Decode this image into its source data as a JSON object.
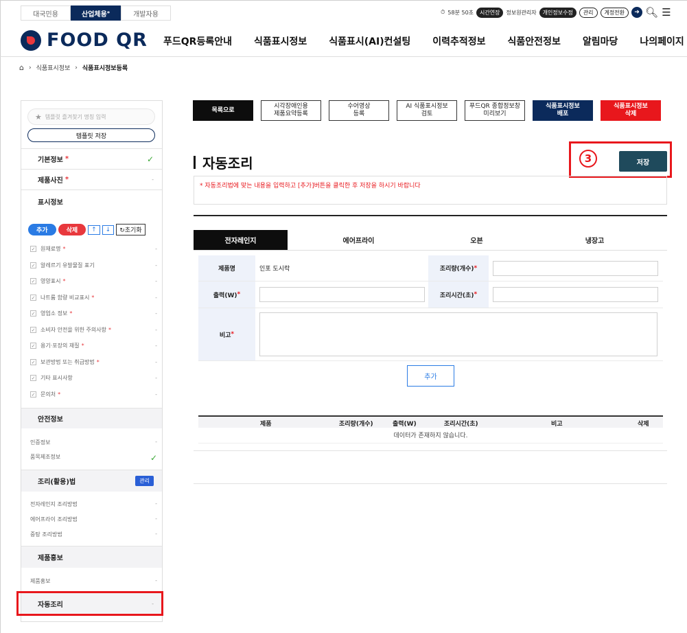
{
  "site_tabs": [
    "대국민용",
    "산업체용",
    "개발자용"
  ],
  "site_tab_active_sup": "*",
  "util": {
    "timer": "58분 50초",
    "extend": "시간연장",
    "manager": "정보원관리자",
    "edit_info": "개인정보수정",
    "admin": "관리",
    "switch_account": "계정전환"
  },
  "logo": "FOOD QR",
  "gnb": [
    "푸드QR등록안내",
    "식품표시정보",
    "식품표시(AI)컨설팅",
    "이력추적정보",
    "식품안전정보",
    "알림마당",
    "나의페이지"
  ],
  "breadcrumb": [
    "식품표시정보",
    "식품표시정보등록"
  ],
  "sidebar": {
    "search_placeholder": "템플릿 즐겨찾기 명칭 입력",
    "template_save": "템플릿 저장",
    "basic_info": "기본정보",
    "product_photo": "제품사진",
    "display_info": "표시정보",
    "tools": {
      "add": "추가",
      "delete": "삭제",
      "up": "↑",
      "down": "↓",
      "reset": "초기화"
    },
    "display_items": [
      {
        "label": "원재료명",
        "req": "*"
      },
      {
        "label": "알레르기 유발물질 표기",
        "req": ""
      },
      {
        "label": "영양표시",
        "req": "*"
      },
      {
        "label": "나트륨 함량 비교표시",
        "req": "*"
      },
      {
        "label": "영업소 정보",
        "req": "*"
      },
      {
        "label": "소비자 안전을 위한 주의사항",
        "req": "*"
      },
      {
        "label": "용기·포장의 재질",
        "req": "*"
      },
      {
        "label": "보관방법 또는 취급방법",
        "req": "*"
      },
      {
        "label": "기타 표시사항",
        "req": ""
      },
      {
        "label": "문의처",
        "req": "*"
      }
    ],
    "safety_info": "안전정보",
    "cert_info": "인증정보",
    "mfg_info": "품목제조정보",
    "cooking": "조리(활용)법",
    "manage": "관리",
    "cooking_items": [
      "전자레인지 조리방법",
      "에어프라이 조리방법",
      "중탕 조리방법"
    ],
    "promo": "제품홍보",
    "promo_item": "제품홍보",
    "auto_cook": "자동조리",
    "required_mark": "*",
    "dash": "-"
  },
  "actions": [
    "목록으로",
    "시각장애인용\n제품요약등록",
    "수어영상\n등록",
    "AI 식품표시정보\n검토",
    "푸드QR 종합정보창\n미리보기",
    "식품표시정보\n배포",
    "식품표시정보\n삭제"
  ],
  "page_title": "자동조리",
  "step_number": "3",
  "save_label": "저장",
  "notice": "* 자동조리법에 맞는 내용을 입력하고 [추가]버튼을 클릭한 후 저장을 하시기 바랍니다",
  "tabs": [
    "전자레인지",
    "에어프라이",
    "오븐",
    "냉장고"
  ],
  "form": {
    "product_label": "제품명",
    "product_value": "인포 도시락",
    "cook_qty_label": "조리량(개수)",
    "power_label": "출력(W)",
    "cook_time_label": "조리시간(초)",
    "note_label": "비고",
    "required_mark": "*"
  },
  "add_label": "추가",
  "table": {
    "headers": [
      "제품",
      "조리량(개수)",
      "출력(W)",
      "조리시간(초)",
      "비고",
      "삭제"
    ],
    "empty": "데이터가 존재하지 않습니다."
  }
}
